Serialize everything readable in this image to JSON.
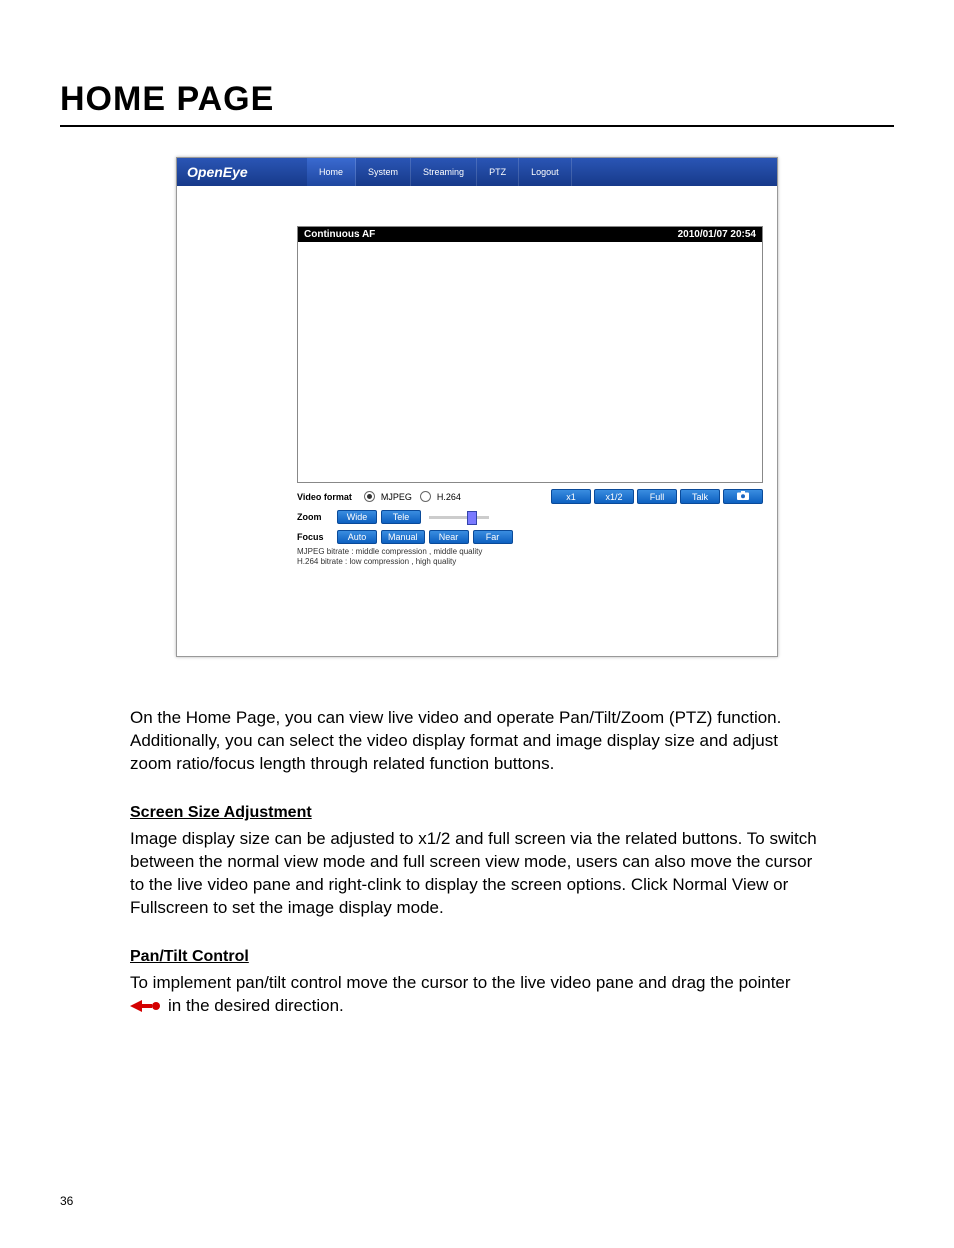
{
  "page": {
    "title": "HOME PAGE",
    "number": "36"
  },
  "app": {
    "logo": "OpenEye",
    "tabs": [
      "Home",
      "System",
      "Streaming",
      "PTZ",
      "Logout"
    ],
    "status_left": "Continuous AF",
    "status_right": "2010/01/07 20:54",
    "video_format_label": "Video format",
    "format_options": [
      "MJPEG",
      "H.264"
    ],
    "right_buttons": [
      "x1",
      "x1/2",
      "Full",
      "Talk"
    ],
    "zoom_label": "Zoom",
    "zoom_buttons": [
      "Wide",
      "Tele"
    ],
    "focus_label": "Focus",
    "focus_buttons": [
      "Auto",
      "Manual",
      "Near",
      "Far"
    ],
    "bitrate_line1": "MJPEG bitrate : middle compression , middle quality",
    "bitrate_line2": "H.264 bitrate : low compression , high quality"
  },
  "text": {
    "intro": "On the Home Page, you can view live video and operate Pan/Tilt/Zoom (PTZ) function. Additionally, you can select the video display format and image display size and adjust zoom ratio/focus length through related function buttons.",
    "section1_title": "Screen Size Adjustment",
    "section1_body": "Image display size can be adjusted to x1/2 and full screen via the related buttons. To switch between the normal view mode and full screen view mode, users can also move the cursor to the live video pane and right-clink to display the screen options. Click Normal View or Fullscreen to set the image display mode.",
    "section2_title": "Pan/Tilt Control",
    "section2_line1": "To implement pan/tilt control move the cursor to the live video pane and drag the pointer",
    "section2_line2": "in the desired direction."
  }
}
